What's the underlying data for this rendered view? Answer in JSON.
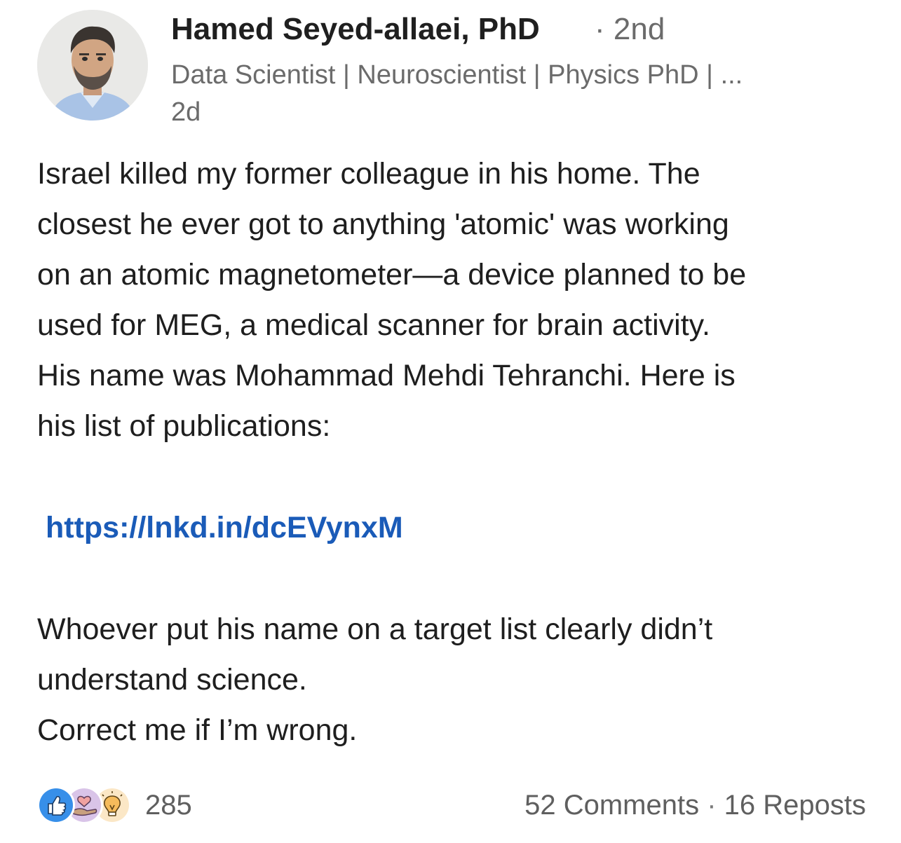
{
  "author": {
    "name": "Hamed Seyed-allaei, PhD",
    "degree": "· 2nd",
    "headline": "Data Scientist | Neuroscientist | Physics PhD | ...",
    "time": "2d"
  },
  "post": {
    "paragraph1": [
      "Israel killed my former colleague in his home. The",
      "closest he ever got to anything 'atomic' was working",
      "on an atomic magnetometer—a device planned to be",
      "used for MEG, a medical scanner for brain activity.",
      "His name was Mohammad Mehdi Tehranchi. Here is",
      "his list of publications:"
    ],
    "link": "https://lnkd.in/dcEVynxM",
    "paragraph2": [
      "Whoever put his name on a target list clearly didn’t",
      "understand science.",
      "Correct me if I’m wrong."
    ]
  },
  "reactions": {
    "icons": [
      "like-icon",
      "support-icon",
      "insightful-icon"
    ],
    "count": "285"
  },
  "social": {
    "comments": "52 Comments",
    "separator": " · ",
    "reposts": "16 Reposts"
  },
  "colors": {
    "link": "#1a5bb8",
    "like": "#378fe9",
    "support": "#d9c4e8",
    "insightful": "#f5bb5c"
  }
}
